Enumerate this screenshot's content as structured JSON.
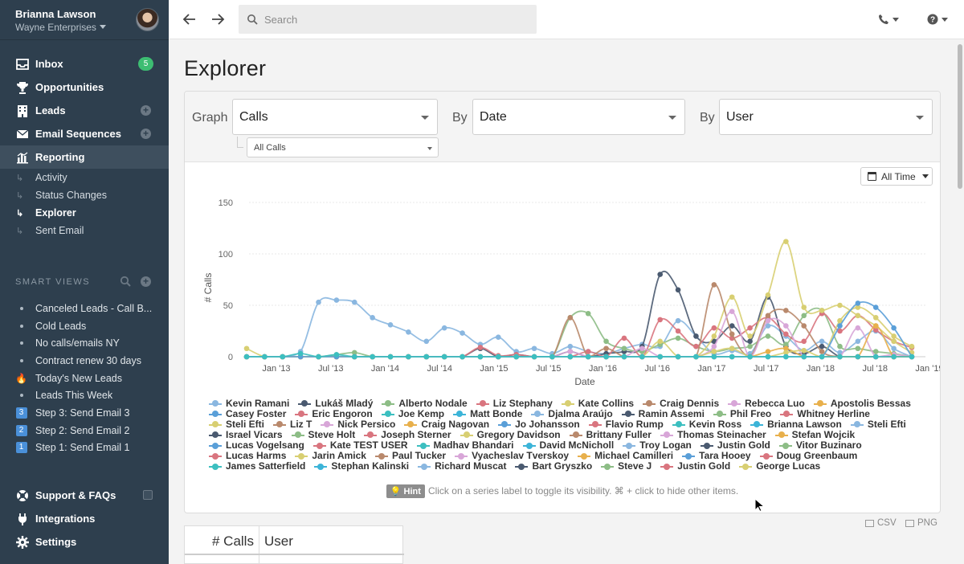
{
  "account": {
    "name": "Brianna Lawson",
    "org": "Wayne Enterprises"
  },
  "nav": [
    {
      "label": "Inbox",
      "icon": "inbox-icon",
      "badge": "5"
    },
    {
      "label": "Opportunities",
      "icon": "trophy-icon"
    },
    {
      "label": "Leads",
      "icon": "building-icon",
      "plus": true
    },
    {
      "label": "Email Sequences",
      "icon": "envelope-icon",
      "plus": true
    },
    {
      "label": "Reporting",
      "icon": "bar-chart-icon",
      "active": true
    }
  ],
  "reporting_sub": [
    "Activity",
    "Status Changes",
    "Explorer",
    "Sent Email"
  ],
  "smart_views": {
    "title": "SMART VIEWS",
    "items": [
      {
        "label": "Canceled Leads - Call B...",
        "marker": "dot"
      },
      {
        "label": "Cold Leads",
        "marker": "dot"
      },
      {
        "label": "No calls/emails NY",
        "marker": "dot"
      },
      {
        "label": "Contract renew 30 days",
        "marker": "dot"
      },
      {
        "label": "Today's New Leads",
        "marker": "fire"
      },
      {
        "label": "Leads This Week",
        "marker": "dot"
      },
      {
        "label": "Step 3: Send Email 3",
        "marker": "3"
      },
      {
        "label": "Step 2: Send Email 2",
        "marker": "2"
      },
      {
        "label": "Step 1: Send Email 1",
        "marker": "1"
      }
    ]
  },
  "bottom_nav": [
    "Support & FAQs",
    "Integrations",
    "Settings"
  ],
  "search": {
    "placeholder": "Search"
  },
  "page_title": "Explorer",
  "controls": {
    "graph_label": "Graph",
    "graph_value": "Calls",
    "graph_sub_value": "All Calls",
    "by1_label": "By",
    "by1_value": "Date",
    "by2_label": "By",
    "by2_value": "User"
  },
  "time_range": "All Time",
  "hint": {
    "badge": "Hint",
    "text": "Click on a series label to toggle its visibility. ⌘ + click to hide other items."
  },
  "exports": {
    "csv": "CSV",
    "png": "PNG"
  },
  "table": {
    "headers": [
      "# Calls",
      "User"
    ]
  },
  "chart_data": {
    "type": "line",
    "xlabel": "Date",
    "ylabel": "# Calls",
    "yticks": [
      "0",
      "50",
      "100",
      "150"
    ],
    "ylim": [
      0,
      150
    ],
    "xticks": [
      "Jan '13",
      "Jul '13",
      "Jan '14",
      "Jul '14",
      "Jan '15",
      "Jul '15",
      "Jan '16",
      "Jul '16",
      "Jan '17",
      "Jul '17",
      "Jan '18",
      "Jul '18",
      "Jan '19"
    ],
    "x": [
      "Nov '12",
      "Jan '13",
      "Apr '13",
      "Jun '13",
      "Aug '13",
      "Oct '13",
      "Dec '13",
      "Feb '14",
      "Apr '14",
      "Jun '14",
      "Aug '14",
      "Oct '14",
      "Dec '14",
      "Feb '15",
      "Apr '15",
      "Jun '15",
      "Aug '15",
      "Oct '15",
      "Dec '15",
      "Feb '16",
      "Apr '16",
      "Jun '16",
      "Aug '16",
      "Oct '16",
      "Dec '16",
      "Feb '17",
      "Apr '17",
      "Jun '17",
      "Aug '17",
      "Oct '17",
      "Dec '17",
      "Feb '18",
      "Apr '18",
      "Jun '18",
      "Aug '18",
      "Oct '18",
      "Dec '18",
      "Feb '19"
    ],
    "grid": true,
    "series": [
      {
        "name": "Kevin Ramani",
        "color": "#8ab7e0",
        "values": [
          0,
          0,
          0,
          5,
          53,
          55,
          53,
          38,
          31,
          24,
          15,
          28,
          23,
          12,
          19,
          5,
          8,
          3,
          10,
          5,
          3,
          8,
          12,
          10,
          35,
          20,
          3,
          6,
          3,
          30,
          20,
          6,
          15,
          4,
          15,
          25,
          8,
          0
        ]
      },
      {
        "name": "Lukáš Mladý",
        "color": "#4a5a70",
        "values": [
          0,
          0,
          0,
          0,
          0,
          0,
          0,
          0,
          0,
          0,
          0,
          0,
          0,
          8,
          0,
          2,
          0,
          0,
          5,
          0,
          3,
          5,
          10,
          80,
          65,
          20,
          15,
          30,
          15,
          58,
          10,
          3,
          10,
          0,
          0,
          0,
          0,
          0
        ]
      },
      {
        "name": "Alberto Nodale",
        "color": "#8dbd86",
        "values": [
          0,
          0,
          0,
          0,
          0,
          2,
          4,
          0,
          0,
          0,
          0,
          0,
          0,
          0,
          0,
          0,
          0,
          0,
          38,
          42,
          15,
          8,
          5,
          12,
          18,
          10,
          5,
          8,
          10,
          20,
          12,
          40,
          45,
          10,
          8,
          5,
          3,
          0
        ]
      },
      {
        "name": "Liz Stephany",
        "color": "#d9757f",
        "values": [
          0,
          0,
          0,
          0,
          0,
          0,
          0,
          0,
          0,
          0,
          0,
          0,
          0,
          9,
          1,
          2,
          0,
          0,
          0,
          5,
          0,
          18,
          0,
          36,
          25,
          10,
          28,
          18,
          28,
          38,
          22,
          15,
          42,
          25,
          40,
          26,
          15,
          9
        ]
      },
      {
        "name": "Kate Collins",
        "color": "#d8cf72",
        "values": [
          8,
          0,
          0,
          0,
          0,
          0,
          0,
          0,
          0,
          0,
          0,
          0,
          0,
          0,
          0,
          0,
          0,
          0,
          0,
          0,
          0,
          0,
          0,
          15,
          0,
          0,
          20,
          58,
          20,
          60,
          112,
          48,
          45,
          50,
          40,
          30,
          15,
          4
        ]
      },
      {
        "name": "Craig Dennis",
        "color": "#b9896c",
        "values": [
          0,
          0,
          0,
          0,
          0,
          0,
          0,
          0,
          0,
          0,
          0,
          0,
          0,
          0,
          0,
          0,
          0,
          0,
          38,
          0,
          8,
          0,
          0,
          0,
          0,
          0,
          70,
          22,
          0,
          40,
          45,
          30,
          5,
          0,
          0,
          0,
          0,
          0
        ]
      },
      {
        "name": "Rebecca Luo",
        "color": "#d8a6d8",
        "values": [
          0,
          0,
          0,
          0,
          0,
          0,
          0,
          0,
          0,
          0,
          0,
          0,
          0,
          0,
          0,
          0,
          0,
          0,
          5,
          0,
          0,
          0,
          8,
          0,
          0,
          0,
          10,
          44,
          0,
          35,
          30,
          0,
          0,
          0,
          28,
          0,
          2,
          0
        ]
      },
      {
        "name": "Apostolis Bessas",
        "color": "#e8b04c",
        "values": [
          0,
          0,
          0,
          0,
          0,
          0,
          0,
          0,
          0,
          0,
          0,
          0,
          0,
          0,
          0,
          0,
          0,
          0,
          0,
          0,
          0,
          0,
          0,
          0,
          0,
          0,
          0,
          0,
          0,
          5,
          8,
          0,
          0,
          0,
          0,
          30,
          0,
          0
        ]
      },
      {
        "name": "Steli Efti",
        "color": "#d8cf72",
        "values": [
          0,
          0,
          0,
          0,
          0,
          0,
          0,
          0,
          0,
          0,
          0,
          0,
          0,
          0,
          0,
          0,
          0,
          0,
          0,
          0,
          0,
          0,
          0,
          0,
          0,
          0,
          5,
          8,
          0,
          0,
          4,
          6,
          0,
          35,
          48,
          38,
          20,
          10
        ]
      },
      {
        "name": "Casey Foster",
        "color": "#5a9fd8",
        "values": [
          0,
          0,
          0,
          0,
          0,
          0,
          0,
          0,
          0,
          0,
          0,
          0,
          0,
          0,
          0,
          0,
          0,
          0,
          0,
          0,
          0,
          0,
          0,
          0,
          0,
          0,
          0,
          0,
          0,
          0,
          0,
          0,
          0,
          30,
          52,
          48,
          28,
          0
        ]
      },
      {
        "name": "Joe Kemp",
        "color": "#3cbfc0",
        "values": [
          0,
          0,
          0,
          3,
          0,
          2,
          0,
          0,
          0,
          0,
          0,
          0,
          0,
          0,
          0,
          0,
          0,
          0,
          0,
          0,
          0,
          0,
          0,
          0,
          0,
          0,
          0,
          0,
          0,
          0,
          0,
          0,
          0,
          0,
          0,
          0,
          0,
          0
        ]
      }
    ],
    "legend": [
      {
        "name": "Kevin Ramani",
        "color": "#8ab7e0"
      },
      {
        "name": "Lukáš Mladý",
        "color": "#4a5a70"
      },
      {
        "name": "Alberto Nodale",
        "color": "#8dbd86"
      },
      {
        "name": "Liz Stephany",
        "color": "#d9757f"
      },
      {
        "name": "Kate Collins",
        "color": "#d8cf72"
      },
      {
        "name": "Craig Dennis",
        "color": "#b9896c"
      },
      {
        "name": "Rebecca Luo",
        "color": "#d8a6d8"
      },
      {
        "name": "Apostolis Bessas",
        "color": "#e8b04c"
      },
      {
        "name": "Casey Foster",
        "color": "#5a9fd8"
      },
      {
        "name": "Eric Engoron",
        "color": "#d9757f"
      },
      {
        "name": "Joe Kemp",
        "color": "#3cbfc0"
      },
      {
        "name": "Matt Bonde",
        "color": "#3cb4d8"
      },
      {
        "name": "Djalma Araújo",
        "color": "#8ab7e0"
      },
      {
        "name": "Ramin Assemi",
        "color": "#4a5a70"
      },
      {
        "name": "Phil Freo",
        "color": "#8dbd86"
      },
      {
        "name": "Whitney Herline",
        "color": "#d9757f"
      },
      {
        "name": "Steli Efti",
        "color": "#d8cf72"
      },
      {
        "name": "Liz T",
        "color": "#b9896c"
      },
      {
        "name": "Nick Persico",
        "color": "#d8a6d8"
      },
      {
        "name": "Craig Nagovan",
        "color": "#e8b04c"
      },
      {
        "name": "Jo Johansson",
        "color": "#5a9fd8"
      },
      {
        "name": "Flavio Rump",
        "color": "#d9757f"
      },
      {
        "name": "Kevin Ross",
        "color": "#3cbfc0"
      },
      {
        "name": "Brianna Lawson",
        "color": "#3cb4d8"
      },
      {
        "name": "Steli Efti",
        "color": "#8ab7e0"
      },
      {
        "name": "Israel Vicars",
        "color": "#4a5a70"
      },
      {
        "name": "Steve Holt",
        "color": "#8dbd86"
      },
      {
        "name": "Joseph Sterner",
        "color": "#d9757f"
      },
      {
        "name": "Gregory Davidson",
        "color": "#d8cf72"
      },
      {
        "name": "Brittany Fuller",
        "color": "#b9896c"
      },
      {
        "name": "Thomas Steinacher",
        "color": "#d8a6d8"
      },
      {
        "name": "Stefan Wojcik",
        "color": "#e8b04c"
      },
      {
        "name": "Lucas Vogelsang",
        "color": "#5a9fd8"
      },
      {
        "name": "Kate TEST USER",
        "color": "#d9757f"
      },
      {
        "name": "Madhav Bhandari",
        "color": "#3cbfc0"
      },
      {
        "name": "David McNicholl",
        "color": "#3cb4d8"
      },
      {
        "name": "Troy Logan",
        "color": "#8ab7e0"
      },
      {
        "name": "Justin Gold",
        "color": "#4a5a70"
      },
      {
        "name": "Vitor Buzinaro",
        "color": "#8dbd86"
      },
      {
        "name": "Lucas Harms",
        "color": "#d9757f"
      },
      {
        "name": "Jarin Amick",
        "color": "#d8cf72"
      },
      {
        "name": "Paul Tucker",
        "color": "#b9896c"
      },
      {
        "name": "Vyacheslav Tverskoy",
        "color": "#d8a6d8"
      },
      {
        "name": "Michael Camilleri",
        "color": "#e8b04c"
      },
      {
        "name": "Tara Hooey",
        "color": "#5a9fd8"
      },
      {
        "name": "Doug Greenbaum",
        "color": "#d9757f"
      },
      {
        "name": "James Satterfield",
        "color": "#3cbfc0"
      },
      {
        "name": "Stephan Kalinski",
        "color": "#3cb4d8"
      },
      {
        "name": "Richard Muscat",
        "color": "#8ab7e0"
      },
      {
        "name": "Bart Gryszko",
        "color": "#4a5a70"
      },
      {
        "name": "Steve J",
        "color": "#8dbd86"
      },
      {
        "name": "Justin Gold",
        "color": "#d9757f"
      },
      {
        "name": "George Lucas",
        "color": "#d8cf72"
      }
    ]
  }
}
